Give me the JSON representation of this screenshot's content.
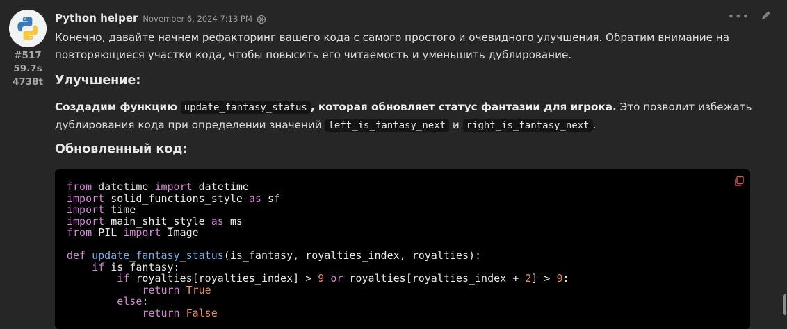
{
  "post": {
    "author": "Python helper",
    "timestamp": "November 6, 2024 7:13 PM",
    "model_icon": "openai-icon",
    "stats": {
      "message_id": "#517",
      "time": "59.7s",
      "tokens": "4738t"
    },
    "actions": {
      "more": "more-options-icon",
      "edit": "pencil-icon"
    }
  },
  "content": {
    "intro": "Конечно, давайте начнем рефакторинг вашего кода с самого простого и очевидного улучшения. Обратим внимание на повторяющиеся участки кода, чтобы повысить его читаемость и уменьшить дублирование.",
    "heading_improvement": "Улучшение:",
    "p2_bold_1": "Создадим функцию",
    "p2_code_1": "update_fantasy_status",
    "p2_bold_2": ", которая обновляет статус фантазии для игрока.",
    "p2_text_1": " Это позволит избежать дублирования кода при определении значений ",
    "p2_code_2": "left_is_fantasy_next",
    "p2_text_2": " и ",
    "p2_code_3": "right_is_fantasy_next",
    "p2_text_3": ".",
    "heading_code": "Обновленный код:"
  },
  "code_block": {
    "copy_icon": "copy-icon",
    "lines": [
      "from datetime import datetime",
      "import solid_functions_style as sf",
      "import time",
      "import main_shit_style as ms",
      "from PIL import Image",
      "",
      "def update_fantasy_status(is_fantasy, royalties_index, royalties):",
      "    if is_fantasy:",
      "        if royalties[royalties_index] > 9 or royalties[royalties_index + 2] > 9:",
      "            return True",
      "        else:",
      "            return False"
    ]
  },
  "colors": {
    "background": "#262626",
    "code_bg": "#000000",
    "keyword": "#d783d8",
    "function": "#6fb3ec",
    "number": "#f08a4b"
  }
}
